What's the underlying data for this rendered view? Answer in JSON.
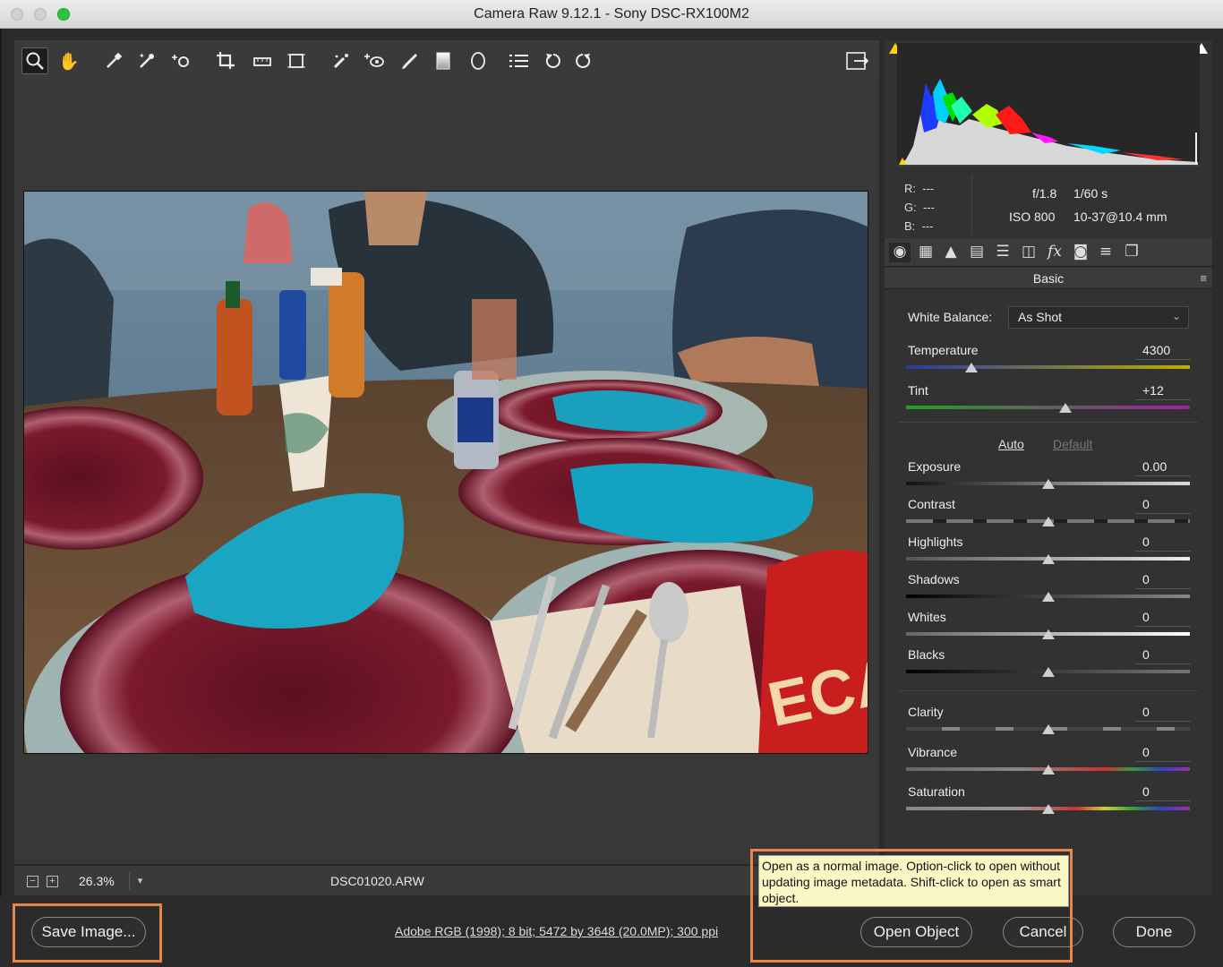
{
  "window": {
    "title": "Camera Raw 9.12.1  -  Sony DSC-RX100M2"
  },
  "toolbar": {
    "tools": [
      "zoom-icon",
      "hand-icon",
      "white-balance-icon",
      "color-sampler-icon",
      "targeted-adjustment-icon",
      "crop-icon",
      "straighten-icon",
      "transform-icon",
      "spot-removal-icon",
      "red-eye-icon",
      "adjustment-brush-icon",
      "graduated-filter-icon",
      "radial-filter-icon",
      "preferences-icon",
      "rotate-left-icon",
      "rotate-right-icon"
    ],
    "active_tool": "zoom-icon",
    "toggle_fullscreen_icon": "fullscreen-icon"
  },
  "status": {
    "zoom": "26.3%",
    "filename": "DSC01020.ARW"
  },
  "readout": {
    "r_label": "R:",
    "r_value": "---",
    "g_label": "G:",
    "g_value": "---",
    "b_label": "B:",
    "b_value": "---",
    "aperture": "f/1.8",
    "shutter": "1/60 s",
    "iso": "ISO 800",
    "lens": "10-37@10.4 mm"
  },
  "panel": {
    "title": "Basic",
    "white_balance_label": "White Balance:",
    "white_balance_value": "As Shot",
    "auto": "Auto",
    "default": "Default",
    "sliders": [
      {
        "label": "Temperature",
        "value": "4300",
        "position": 0.23
      },
      {
        "label": "Tint",
        "value": "+12",
        "position": 0.56
      },
      {
        "label": "Exposure",
        "value": "0.00",
        "position": 0.5
      },
      {
        "label": "Contrast",
        "value": "0",
        "position": 0.5
      },
      {
        "label": "Highlights",
        "value": "0",
        "position": 0.5
      },
      {
        "label": "Shadows",
        "value": "0",
        "position": 0.5
      },
      {
        "label": "Whites",
        "value": "0",
        "position": 0.5
      },
      {
        "label": "Blacks",
        "value": "0",
        "position": 0.5
      },
      {
        "label": "Clarity",
        "value": "0",
        "position": 0.5
      },
      {
        "label": "Vibrance",
        "value": "0",
        "position": 0.5
      },
      {
        "label": "Saturation",
        "value": "0",
        "position": 0.5
      }
    ]
  },
  "bottom": {
    "save_label": "Save Image...",
    "workflow_options": "Adobe RGB (1998); 8 bit; 5472 by 3648 (20.0MP); 300 ppi",
    "open_label": "Open Object",
    "cancel_label": "Cancel",
    "done_label": "Done",
    "tooltip": "Open as a normal image.  Option-click to open without updating image metadata.  Shift-click to open as smart object."
  },
  "colors": {
    "highlight": "#e8864a",
    "tooltip_bg": "#fbf7c5"
  }
}
